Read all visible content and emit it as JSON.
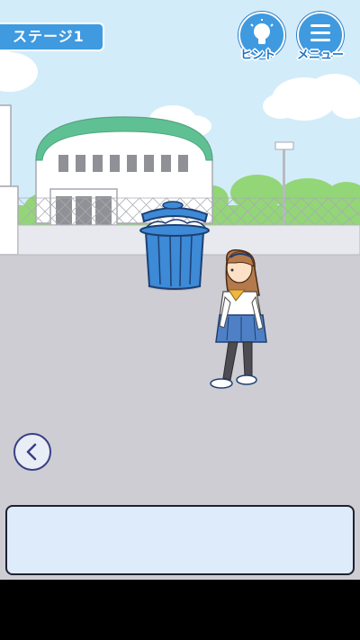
{
  "stage_label": "ステージ1",
  "hint_button": {
    "caption": "ヒント",
    "icon": "lightbulb-icon"
  },
  "menu_button": {
    "caption": "メニュー",
    "icon": "hamburger-menu-icon"
  },
  "back_button": {
    "icon": "chevron-left-icon"
  },
  "message_box": {
    "text": ""
  },
  "colors": {
    "accent": "#3f9ae0",
    "sky": "#d3ecfa",
    "ground": "#cdcdd3",
    "building_roof": "#5fc094",
    "trash_can": "#3d8ad6",
    "message_bg": "#ddebfb"
  }
}
